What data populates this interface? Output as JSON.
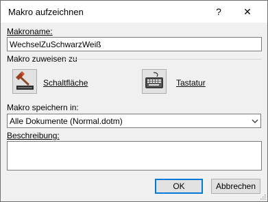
{
  "window": {
    "title": "Makro aufzeichnen",
    "help_label": "?",
    "close_label": "✕"
  },
  "macro_name": {
    "label": "Makroname:",
    "value": "WechselZuSchwarzWeiß"
  },
  "assign": {
    "group_label": "Makro zuweisen zu",
    "button_label": "Schaltfläche",
    "button_icon": "button-hammer-icon",
    "keyboard_label": "Tastatur",
    "keyboard_icon": "keyboard-icon"
  },
  "store": {
    "label": "Makro speichern in:",
    "selected": "Alle Dokumente (Normal.dotm)"
  },
  "description": {
    "label": "Beschreibung:",
    "value": ""
  },
  "actions": {
    "ok_label": "OK",
    "cancel_label": "Abbrechen"
  },
  "colors": {
    "accent": "#0078d7",
    "dialog_bg": "#f0f0f0",
    "button_bg": "#e1e1e1"
  }
}
